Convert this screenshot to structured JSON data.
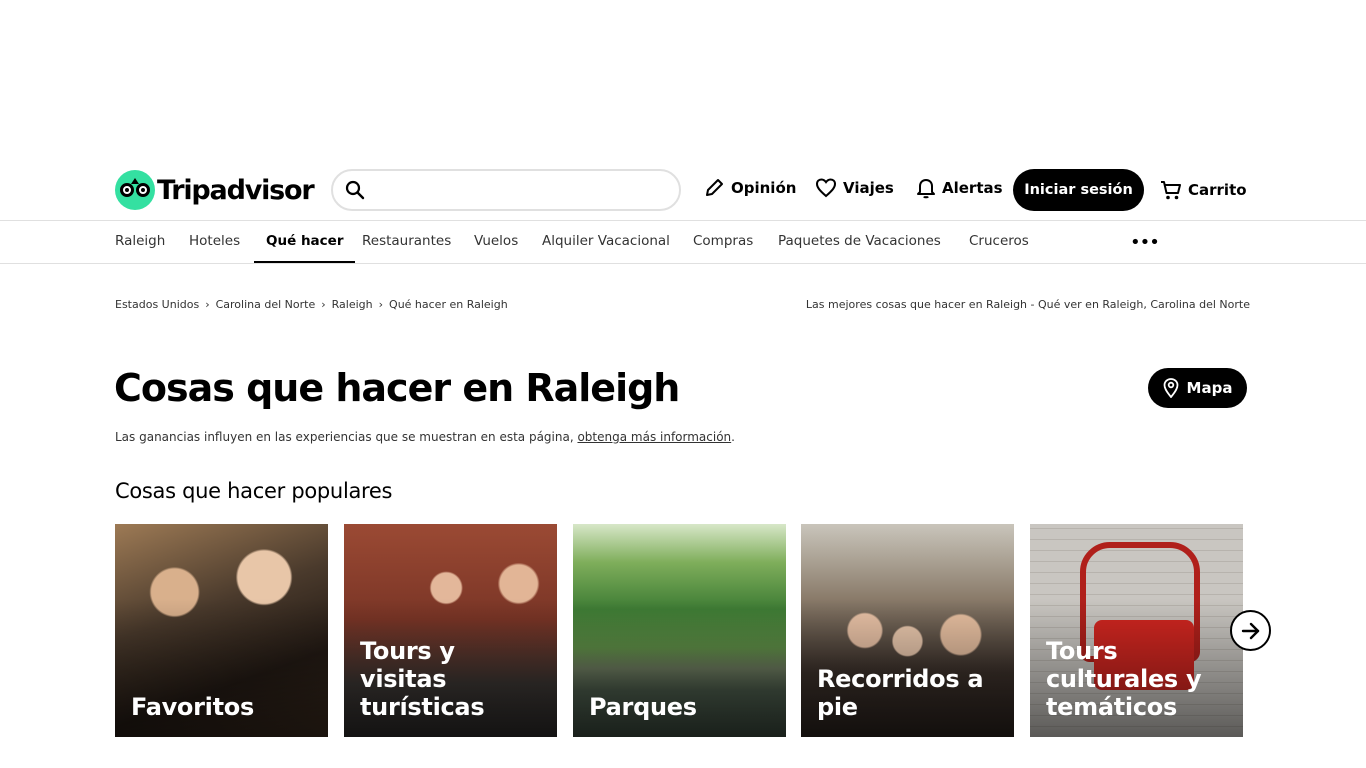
{
  "header": {
    "logo_text": "Tripadvisor",
    "search_placeholder": "",
    "nav": [
      {
        "label": "Opinión",
        "icon": "pencil-icon"
      },
      {
        "label": "Viajes",
        "icon": "heart-icon"
      },
      {
        "label": "Alertas",
        "icon": "bell-icon"
      }
    ],
    "login_label": "Iniciar sesión",
    "cart_label": "Carrito"
  },
  "subnav": {
    "items": [
      "Raleigh",
      "Hoteles",
      "Qué hacer",
      "Restaurantes",
      "Vuelos",
      "Alquiler Vacacional",
      "Compras",
      "Paquetes de Vacaciones",
      "Cruceros"
    ],
    "active": "Qué hacer",
    "more": "•••"
  },
  "breadcrumbs": [
    "Estados Unidos",
    "Carolina del Norte",
    "Raleigh",
    "Qué hacer en Raleigh"
  ],
  "breadcrumb_right": "Las mejores cosas que hacer en Raleigh - Qué ver en Raleigh, Carolina del Norte",
  "page": {
    "title": "Cosas que hacer en Raleigh",
    "map_label": "Mapa",
    "disclaimer": "Las ganancias influyen en las experiencias que se muestran en esta página, ",
    "disclaimer_link": "obtenga más información",
    "disclaimer_end": ".",
    "section_title": "Cosas que hacer populares"
  },
  "cards": [
    {
      "label": "Favoritos"
    },
    {
      "label": "Tours y visitas turísticas"
    },
    {
      "label": "Parques"
    },
    {
      "label": "Recorridos a pie"
    },
    {
      "label": "Tours culturales y temáticos"
    }
  ],
  "colors": {
    "brand_green": "#34e0a1",
    "black": "#000000"
  }
}
